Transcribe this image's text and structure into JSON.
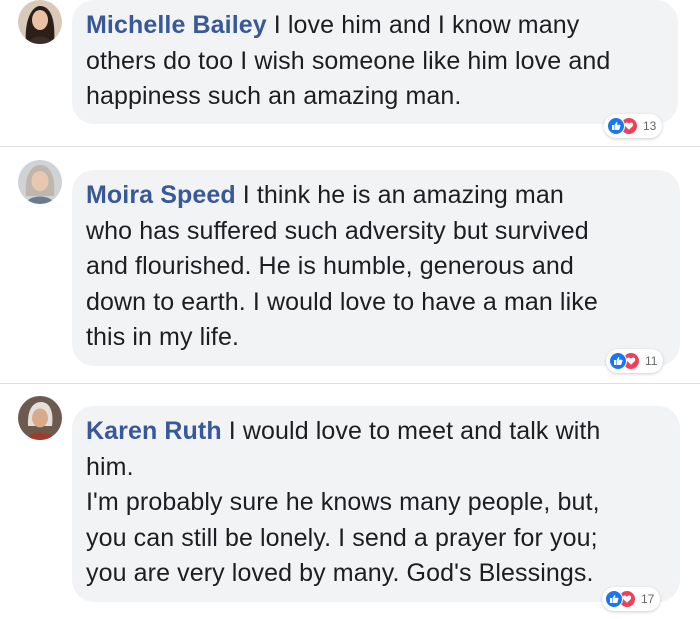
{
  "comments": [
    {
      "author": "Michelle Bailey",
      "lines": [
        " I love him and I know many",
        "others do too I wish someone like him love and",
        "happiness such an amazing man."
      ],
      "reaction_count": "13",
      "reaction_icons": [
        "like-icon",
        "love-icon"
      ]
    },
    {
      "author": "Moira Speed",
      "lines": [
        " I think he is an amazing man",
        "who has suffered such adversity but survived",
        "and flourished. He is humble, generous and",
        "down to earth. I would love to have a man like",
        "this in my life."
      ],
      "reaction_count": "11",
      "reaction_icons": [
        "like-icon",
        "love-icon"
      ]
    },
    {
      "author": "Karen Ruth",
      "lines": [
        " I would love to meet and talk with",
        "him.",
        "I'm probably sure he knows many people, but,",
        "you can still be lonely. I send a prayer for you;",
        "you are very loved by many. God's Blessings."
      ],
      "reaction_count": "17",
      "reaction_icons": [
        "like-icon",
        "love-icon"
      ]
    }
  ],
  "colors": {
    "author": "#385898",
    "bubble": "#f2f3f5",
    "like": "#1877f2",
    "love": "#f33e58"
  }
}
